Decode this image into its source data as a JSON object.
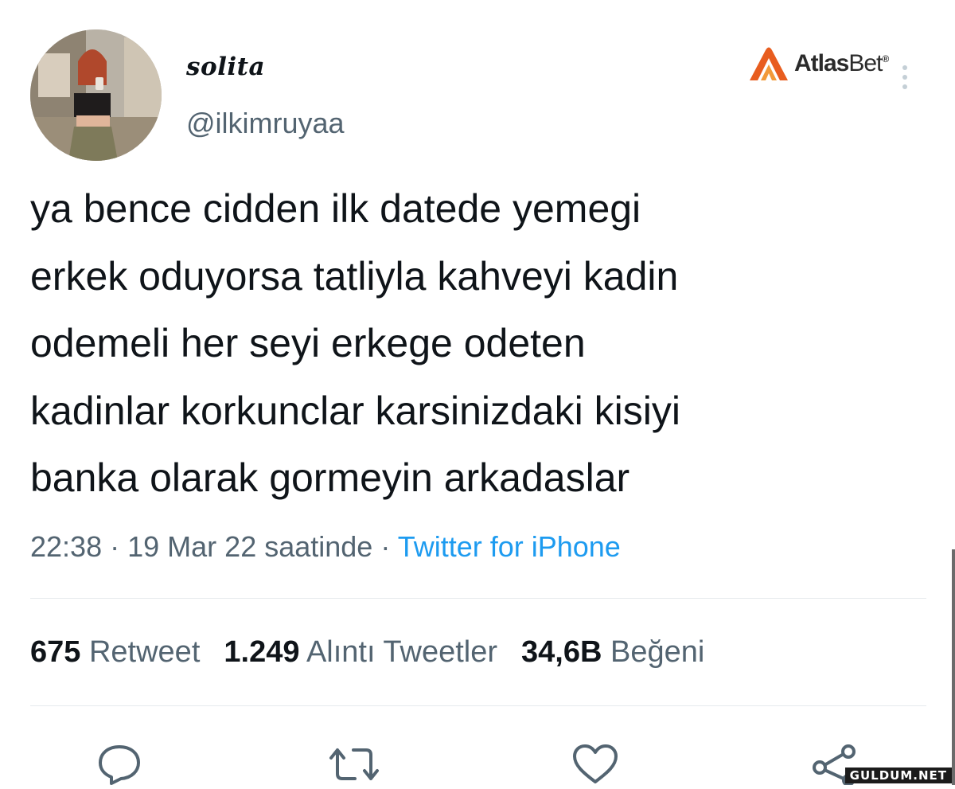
{
  "author": {
    "display_name": "solita",
    "handle": "@ilkimruyaa"
  },
  "brand_logo": {
    "text_bold": "Atlas",
    "text_light": "Bet",
    "registered": "®"
  },
  "tweet": {
    "lines": [
      "ya bence cidden ilk datede yemegi",
      "erkek oduyorsa tatliyla kahveyi kadin",
      "odemeli her seyi erkege odeten",
      "kadinlar korkunclar karsinizdaki kisiyi",
      "banka olarak gormeyin arkadaslar"
    ],
    "time": "22:38",
    "separator": "·",
    "date": "19 Mar 22 saatinde",
    "source": "Twitter for iPhone"
  },
  "stats": {
    "retweet_count": "675",
    "retweet_label": "Retweet",
    "quote_count": "1.249",
    "quote_label": "Alıntı Tweetler",
    "like_count": "34,6B",
    "like_label": "Beğeni"
  },
  "actions": {
    "icons": [
      "reply-icon",
      "retweet-icon",
      "like-icon",
      "share-icon"
    ]
  },
  "watermark": "GULDUM.NET",
  "colors": {
    "text_primary": "#0f1419",
    "text_secondary": "#536471",
    "accent": "#1d9bf0",
    "brand_orange": "#e85d1f",
    "divider": "#e6eaed"
  }
}
